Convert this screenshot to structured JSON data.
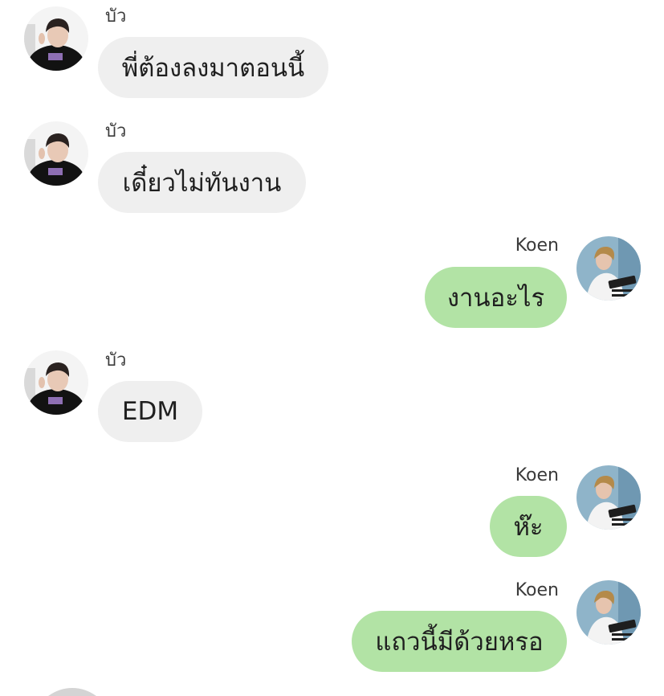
{
  "messages": [
    {
      "sender": "บัว",
      "text": "พี่ต้องลงมาตอนนี้"
    },
    {
      "sender": "บัว",
      "text": "เดี๋ยวไม่ทันงาน"
    },
    {
      "sender": "Koen",
      "text": "งานอะไร"
    },
    {
      "sender": "บัว",
      "text": "EDM"
    },
    {
      "sender": "Koen",
      "text": "ห๊ะ"
    },
    {
      "sender": "Koen",
      "text": "แถวนี้มีด้วยหรอ"
    }
  ],
  "colors": {
    "incoming_bubble": "#efefef",
    "outgoing_bubble": "#b2e3a5",
    "text": "#1f1f1f",
    "sender_name": "#3a3a3a"
  }
}
